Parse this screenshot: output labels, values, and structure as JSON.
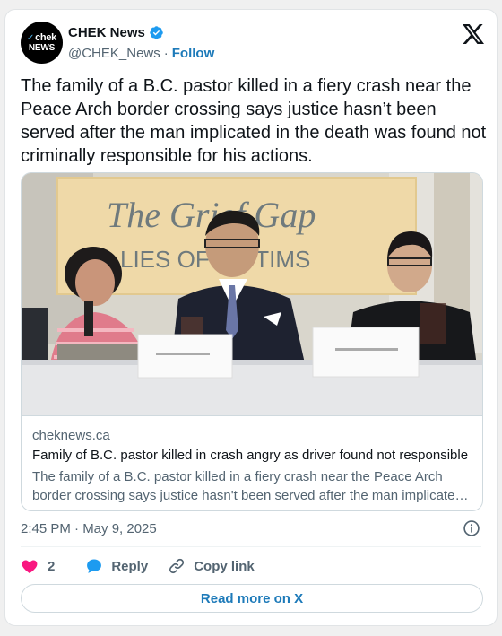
{
  "author": {
    "display_name": "CHEK News",
    "handle": "@CHEK_News",
    "follow_label": "Follow",
    "verified": true,
    "avatar_line1": "chek",
    "avatar_line2": "NEWS"
  },
  "tweet": {
    "text": "The family of a B.C. pastor killed in a fiery crash near the Peace Arch border crossing says justice hasn’t been served after the man implicated in the death was found not criminally responsible for his actions.",
    "timestamp": "2:45 PM · May 9, 2025"
  },
  "link_card": {
    "domain": "cheknews.ca",
    "title": "Family of B.C. pastor killed in crash angry as driver found not responsible",
    "description": "The family of a B.C. pastor killed in a fiery crash near the Peace Arch border crossing says justice hasn't been served after the man implicated in the death was found not criminally responsible for his actions.",
    "image": {
      "icon": "news-photo",
      "banner_line1": "The Grief Gap",
      "banner_line2": "LIES OF   VICTIMS"
    }
  },
  "actions": {
    "like_count": "2",
    "reply_label": "Reply",
    "copy_label": "Copy link"
  },
  "read_more_label": "Read more on X",
  "colors": {
    "link_blue": "#1d7ab9",
    "verified_blue": "#1d9bf0",
    "heart_pink": "#f91880",
    "text_primary": "#0f1419",
    "text_secondary": "#536471"
  }
}
